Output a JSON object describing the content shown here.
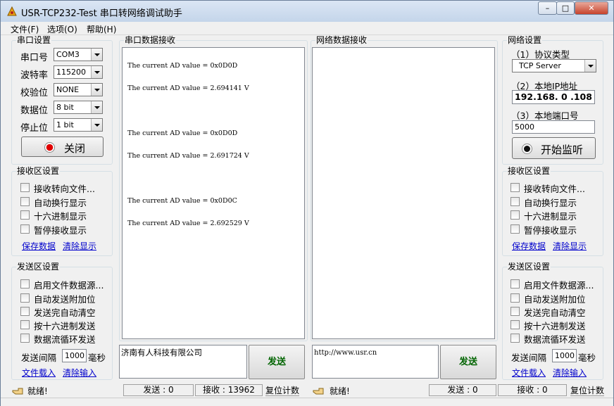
{
  "window": {
    "title": "USR-TCP232-Test 串口转网络调试助手",
    "controls": {
      "minimize": "–",
      "maximize": "□",
      "close": "✕"
    }
  },
  "menu": {
    "file": "文件(F)",
    "options": "选项(O)",
    "help": "帮助(H)"
  },
  "serial_settings": {
    "title": "串口设置",
    "port_label": "串口号",
    "port_value": "COM3",
    "baud_label": "波特率",
    "baud_value": "115200",
    "parity_label": "校验位",
    "parity_value": "NONE",
    "databits_label": "数据位",
    "databits_value": "8 bit",
    "stopbits_label": "停止位",
    "stopbits_value": "1 bit",
    "close_button": "关闭"
  },
  "left_receive_settings": {
    "title": "接收区设置",
    "options": [
      "接收转向文件...",
      "自动换行显示",
      "十六进制显示",
      "暂停接收显示"
    ],
    "save_link": "保存数据",
    "clear_link": "清除显示"
  },
  "left_send_settings": {
    "title": "发送区设置",
    "options": [
      "启用文件数据源...",
      "自动发送附加位",
      "发送完自动清空",
      "按十六进制发送",
      "数据流循环发送"
    ],
    "interval_label": "发送间隔",
    "interval_value": "1000",
    "interval_unit": "毫秒",
    "load_link": "文件载入",
    "clear_link": "清除输入"
  },
  "serial_receive": {
    "title": "串口数据接收",
    "lines": [
      "The current AD value = 0x0D0D",
      "The current AD value = 2.694141 V",
      "The current AD value = 0x0D0D",
      "The current AD value = 2.691724 V",
      "The current AD value = 0x0D0C",
      "The current AD value = 2.692529 V"
    ]
  },
  "network_receive": {
    "title": "网络数据接收"
  },
  "serial_send": {
    "text": "济南有人科技有限公司",
    "button": "发送"
  },
  "network_send": {
    "text": "http://www.usr.cn",
    "button": "发送"
  },
  "network_settings": {
    "title": "网络设置",
    "protocol_label": "（1）协议类型",
    "protocol_value": "TCP Server",
    "ip_label": "（2）本地IP地址",
    "ip_value": "192.168. 0 .108",
    "port_label": "（3）本地端口号",
    "port_value": "5000",
    "listen_button": "开始监听"
  },
  "right_receive_settings": {
    "title": "接收区设置",
    "options": [
      "接收转向文件...",
      "自动换行显示",
      "十六进制显示",
      "暂停接收显示"
    ],
    "save_link": "保存数据",
    "clear_link": "清除显示"
  },
  "right_send_settings": {
    "title": "发送区设置",
    "options": [
      "启用文件数据源...",
      "自动发送附加位",
      "发送完自动清空",
      "按十六进制发送",
      "数据流循环发送"
    ],
    "interval_label": "发送间隔",
    "interval_value": "1000",
    "interval_unit": "毫秒",
    "load_link": "文件载入",
    "clear_link": "清除输入"
  },
  "status_left": {
    "ready": "就绪!",
    "sent": "发送 : 0",
    "received": "接收 : 13962",
    "reset": "复位计数"
  },
  "status_right": {
    "ready": "就绪!",
    "sent": "发送 : 0",
    "received": "接收 : 0",
    "reset": "复位计数"
  },
  "colors": {
    "record_red": "#e00000",
    "send_green": "#006400",
    "link_blue": "#0000cc"
  }
}
